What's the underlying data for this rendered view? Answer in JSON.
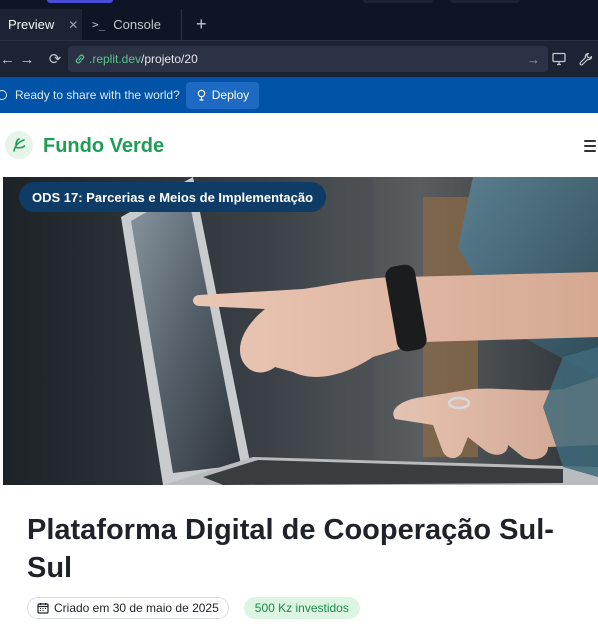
{
  "browser": {
    "tabs": [
      {
        "label": "Preview",
        "icon": "close-icon"
      },
      {
        "label": "Console",
        "icon": "terminal-icon"
      }
    ],
    "url": {
      "domain": ".replit.dev",
      "path": "/projeto/20"
    }
  },
  "banner": {
    "message": "Ready to share with the world?",
    "deploy_label": "Deploy"
  },
  "site": {
    "brand": "Fundo Verde",
    "brand_color": "#1e9e55"
  },
  "project": {
    "ods_badge": "ODS 17: Parcerias e Meios de Implementação",
    "title": "Plataforma Digital de Cooperação Sul-Sul",
    "created": "Criado em 30 de maio de 2025",
    "invested": "500 Kz investidos"
  }
}
